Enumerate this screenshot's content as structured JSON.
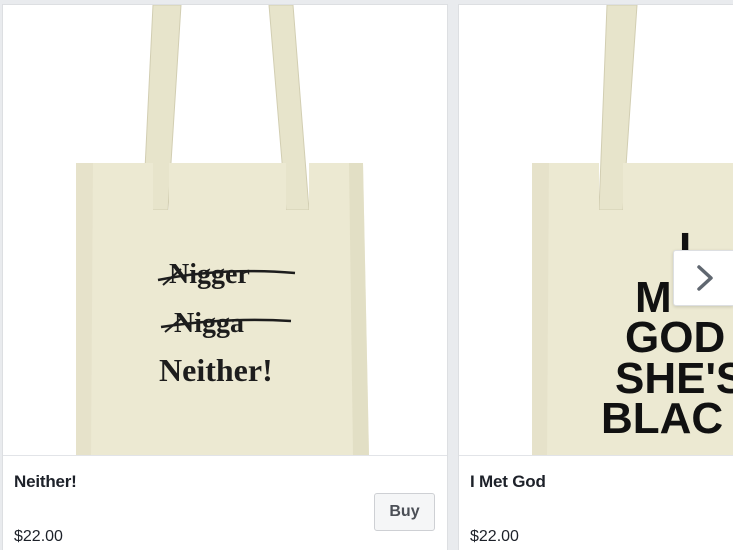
{
  "products": [
    {
      "title": "Neither!",
      "price": "$22.00",
      "buy_label": "Buy",
      "image": {
        "struck_lines": [
          "Nigger",
          "Nigga"
        ],
        "main_line": "Neither!"
      }
    },
    {
      "title": "I Met God",
      "price": "$22.00",
      "image": {
        "lines": [
          "I",
          "M",
          "GOD",
          "SHE'S",
          "BLAC"
        ]
      }
    }
  ],
  "carousel": {
    "next_icon": "chevron-right-icon"
  },
  "colors": {
    "bag": "#ece9d2",
    "bag_shadow": "#dcd8bd",
    "text": "#1d2129",
    "button_bg": "#f5f6f7",
    "border": "#dddfe2"
  }
}
